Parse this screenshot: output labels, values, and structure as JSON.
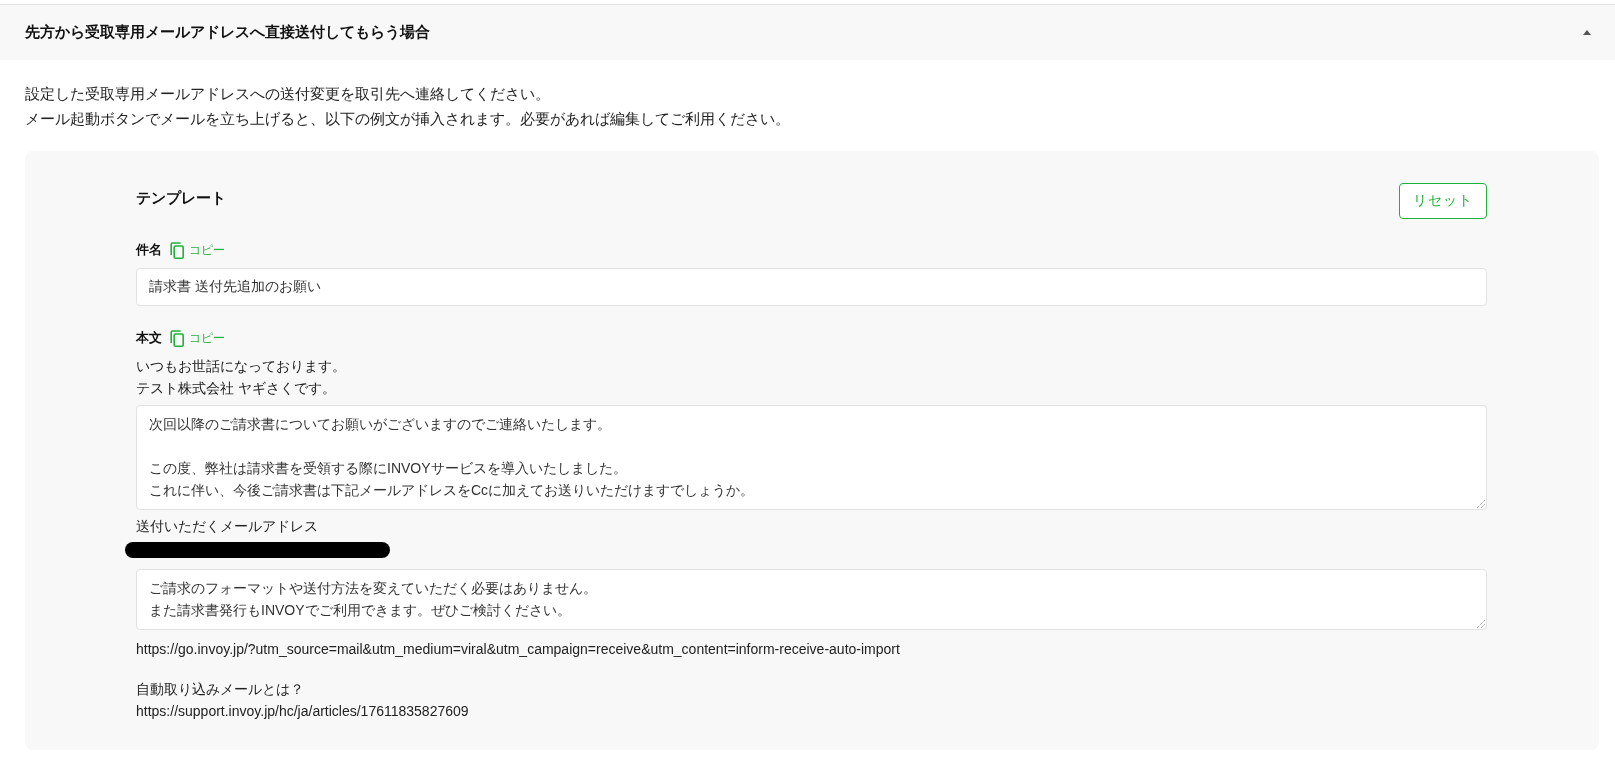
{
  "section": {
    "title": "先方から受取専用メールアドレスへ直接送付してもらう場合",
    "expanded": true
  },
  "intro_lines": [
    "設定した受取専用メールアドレスへの送付変更を取引先へ連絡してください。",
    "メール起動ボタンでメールを立ち上げると、以下の例文が挿入されます。必要があれば編集してご利用ください。"
  ],
  "template": {
    "heading": "テンプレート",
    "reset_button": "リセット",
    "subject": {
      "label": "件名",
      "copy_button": "コピー",
      "value": "請求書 送付先追加のお願い"
    },
    "body": {
      "label": "本文",
      "copy_button": "コピー",
      "blocks": [
        {
          "kind": "text",
          "lines": [
            "いつもお世話になっております。",
            "テスト株式会社 ヤギさくです。"
          ]
        },
        {
          "kind": "textarea",
          "paragraphs": [
            [
              "次回以降のご請求書についてお願いがございますのでご連絡いたします。"
            ],
            [
              "この度、弊社は請求書を受領する際にINVOYサービスを導入いたしました。",
              "これに伴い、今後ご請求書は下記メールアドレスをCcに加えてお送りいただけますでしょうか。"
            ]
          ]
        },
        {
          "kind": "text",
          "lines": [
            "送付いただくメールアドレス"
          ]
        },
        {
          "kind": "redacted"
        },
        {
          "kind": "textarea",
          "paragraphs": [
            [
              "ご請求のフォーマットや送付方法を変えていただく必要はありません。",
              "また請求書発行もINVOYでご利用できます。ぜひご検討ください。"
            ]
          ]
        },
        {
          "kind": "url",
          "lines": [
            "https://go.invoy.jp/?utm_source=mail&utm_medium=viral&utm_campaign=receive&utm_content=inform-receive-auto-import"
          ]
        },
        {
          "kind": "text",
          "lines": [
            "自動取り込みメールとは？"
          ]
        },
        {
          "kind": "url",
          "lines": [
            "https://support.invoy.jp/hc/ja/articles/17611835827609"
          ]
        }
      ]
    }
  }
}
